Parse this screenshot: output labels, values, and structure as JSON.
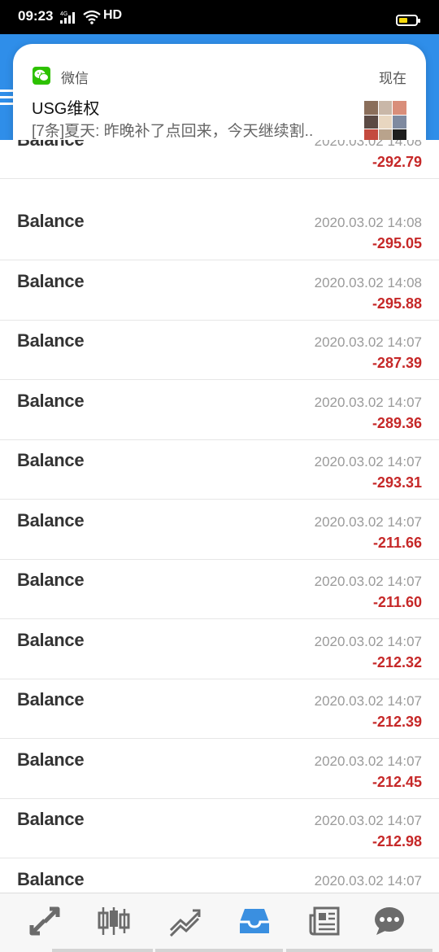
{
  "status": {
    "time": "09:23",
    "network": "4G",
    "hd": "HD"
  },
  "notification": {
    "app": "微信",
    "when": "现在",
    "title": "USG维权",
    "message": "[7条]夏天: 昨晚补了点回来，今天继续割.."
  },
  "rows": [
    {
      "label": "Balance",
      "date": "2020.03.02 14:08",
      "amount": "-292.79"
    },
    {
      "label": "Balance",
      "date": "2020.03.02 14:08",
      "amount": "-295.05"
    },
    {
      "label": "Balance",
      "date": "2020.03.02 14:08",
      "amount": "-295.88"
    },
    {
      "label": "Balance",
      "date": "2020.03.02 14:07",
      "amount": "-287.39"
    },
    {
      "label": "Balance",
      "date": "2020.03.02 14:07",
      "amount": "-289.36"
    },
    {
      "label": "Balance",
      "date": "2020.03.02 14:07",
      "amount": "-293.31"
    },
    {
      "label": "Balance",
      "date": "2020.03.02 14:07",
      "amount": "-211.66"
    },
    {
      "label": "Balance",
      "date": "2020.03.02 14:07",
      "amount": "-211.60"
    },
    {
      "label": "Balance",
      "date": "2020.03.02 14:07",
      "amount": "-212.32"
    },
    {
      "label": "Balance",
      "date": "2020.03.02 14:07",
      "amount": "-212.39"
    },
    {
      "label": "Balance",
      "date": "2020.03.02 14:07",
      "amount": "-212.45"
    },
    {
      "label": "Balance",
      "date": "2020.03.02 14:07",
      "amount": "-212.98"
    },
    {
      "label": "Balance",
      "date": "2020.03.02 14:07",
      "amount": ""
    }
  ],
  "tabs": [
    {
      "icon": "trade-arrows-icon",
      "active": false
    },
    {
      "icon": "candlestick-chart-icon",
      "active": false
    },
    {
      "icon": "trend-lines-icon",
      "active": false
    },
    {
      "icon": "history-inbox-icon",
      "active": true
    },
    {
      "icon": "news-icon",
      "active": false
    },
    {
      "icon": "chat-bubble-icon",
      "active": false
    }
  ],
  "colors": {
    "appbar": "#2f8ee9",
    "negative_amount": "#c62828",
    "tab_active": "#3a8fe0",
    "tab_inactive": "#6b6b6b",
    "wechat_green": "#2dc100"
  }
}
